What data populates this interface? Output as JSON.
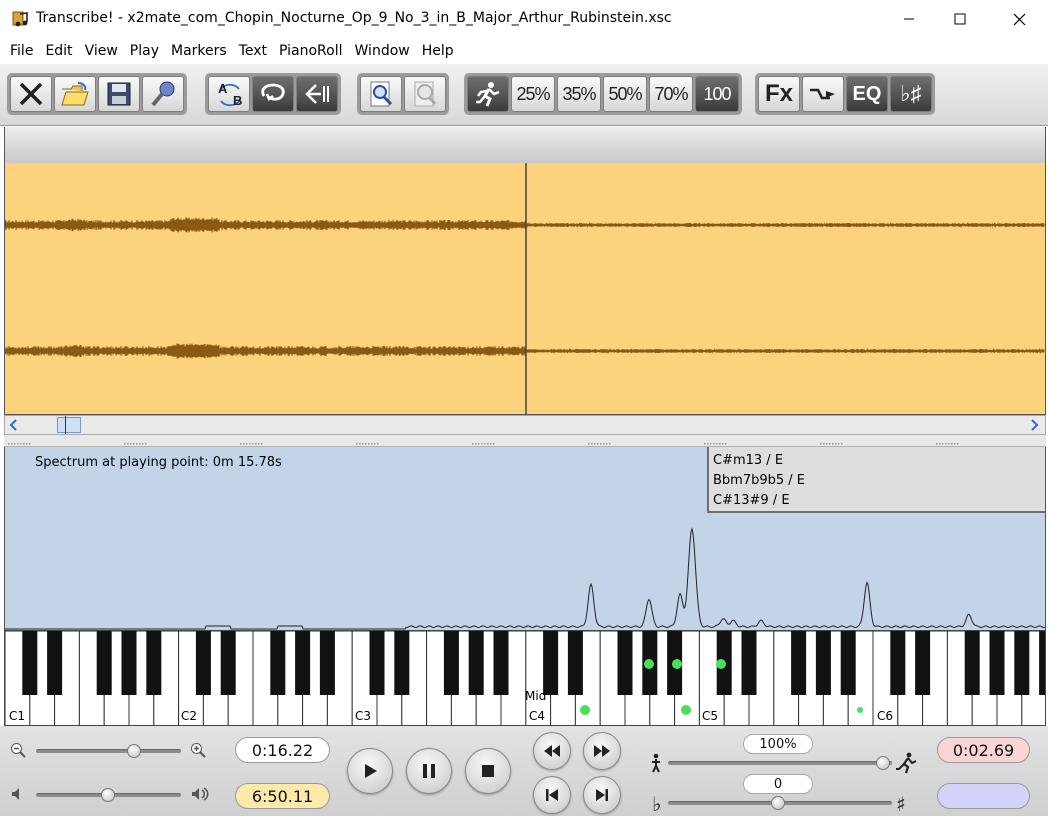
{
  "window": {
    "title": "Transcribe! - x2mate_com_Chopin_Nocturne_Op_9_No_3_in_B_Major_Arthur_Rubinstein.xsc",
    "minimize_icon": "minimize-icon",
    "maximize_icon": "maximize-icon",
    "close_icon": "close-icon"
  },
  "menu": [
    "File",
    "Edit",
    "View",
    "Play",
    "Markers",
    "Text",
    "PianoRoll",
    "Window",
    "Help"
  ],
  "toolbar": {
    "ab_label_a": "A",
    "ab_label_b": "B",
    "speed_labels": [
      "25%",
      "35%",
      "50%",
      "70%",
      "100"
    ],
    "fx_label": "Fx",
    "eq_label": "EQ",
    "flat_sharp_label": "♭♯"
  },
  "spectrum": {
    "label": "Spectrum at playing point: 0m 15.78s",
    "chords": [
      "C#m13 / E",
      "Bbm7b9b5 / E",
      "C#13#9 / E"
    ]
  },
  "piano": {
    "octave_labels": [
      "C1",
      "C2",
      "C3",
      "C4",
      "C5",
      "C6"
    ],
    "middle_label": "Mid"
  },
  "controls": {
    "position_time": "0:16.22",
    "total_time": "6:50.11",
    "loop_time": "0:02.69",
    "speed_value": "100%",
    "transpose_value": "0",
    "flat_symbol": "♭",
    "sharp_symbol": "♯"
  },
  "colors": {
    "waveform_bg": "#fcd27c",
    "waveform_line": "#8b5a12",
    "spectrum_bg": "#c3d4e8",
    "note_dot": "#48e05a",
    "total_time_bg": "#fde9a8",
    "loop_time_bg": "#fbd5d5",
    "loop_blank_bg": "#d4d4fb"
  }
}
